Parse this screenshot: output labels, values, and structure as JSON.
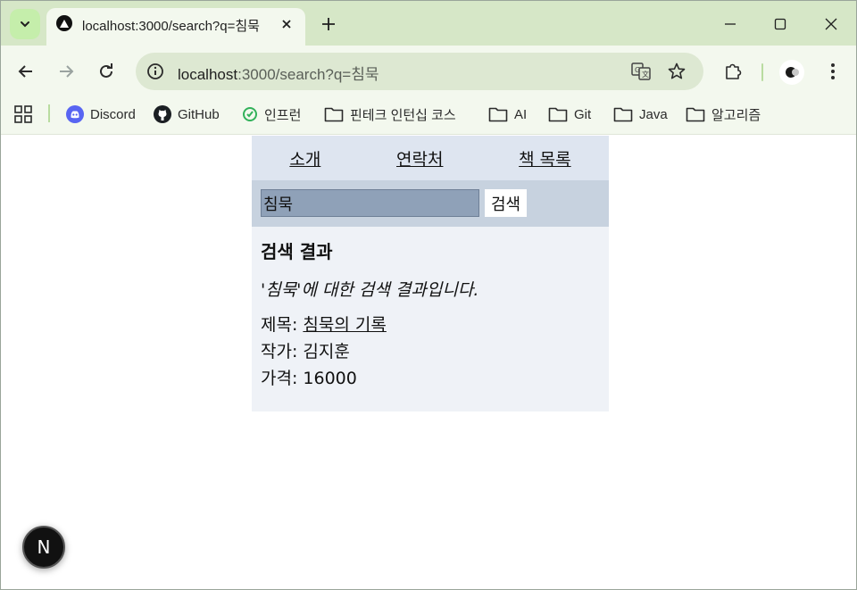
{
  "browser": {
    "tab_title": "localhost:3000/search?q=침묵",
    "url_host": "localhost",
    "url_rest": ":3000/search?q=침묵",
    "bookmarks": [
      {
        "label": "Discord",
        "icon": "discord-icon"
      },
      {
        "label": "GitHub",
        "icon": "github-icon"
      },
      {
        "label": "인프런",
        "icon": "inflearn-icon"
      },
      {
        "label": "핀테크 인턴십 코스",
        "icon": "folder-icon"
      },
      {
        "label": "AI",
        "icon": "folder-icon"
      },
      {
        "label": "Git",
        "icon": "folder-icon"
      },
      {
        "label": "Java",
        "icon": "folder-icon"
      },
      {
        "label": "알고리즘",
        "icon": "folder-icon"
      }
    ],
    "accent": "#d6e7c7"
  },
  "nav": {
    "about": "소개",
    "contact": "연락처",
    "books": "책 목록"
  },
  "search": {
    "value": "침묵",
    "button_label": "검색"
  },
  "results": {
    "heading": "검색 결과",
    "description": "'침묵'에 대한 검색 결과입니다.",
    "title_label": "제목: ",
    "title_value": "침묵의 기록",
    "author_label": "작가: ",
    "author_value": "김지훈",
    "price_label": "가격: ",
    "price_value": "16000"
  },
  "dev_badge": "N"
}
